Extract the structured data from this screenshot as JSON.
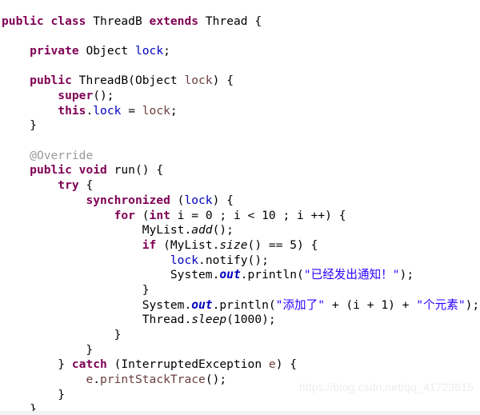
{
  "document": {
    "kind": "source-code-screenshot",
    "language": "Java",
    "class_name": "ThreadB",
    "watermark": "https://blog.csdn.net/qq_41723615"
  },
  "colors": {
    "background": "#ffffff",
    "keyword": "#7f0055",
    "field": "#0000c0",
    "string": "#2a00ff",
    "annotation": "#999999",
    "parameter": "#6a3e3e",
    "plain": "#000000",
    "watermark": "#ededed",
    "bottom_strip": "#f2f2f2"
  },
  "code": {
    "lines": [
      {
        "n": 1,
        "tokens": [
          {
            "t": "public",
            "c": "kw"
          },
          {
            "t": " ",
            "c": "pln"
          },
          {
            "t": "class",
            "c": "kw"
          },
          {
            "t": " ThreadB ",
            "c": "pln"
          },
          {
            "t": "extends",
            "c": "kw"
          },
          {
            "t": " Thread {",
            "c": "pln"
          }
        ]
      },
      {
        "n": 2,
        "tokens": []
      },
      {
        "n": 3,
        "tokens": [
          {
            "t": "    ",
            "c": "pln"
          },
          {
            "t": "private",
            "c": "kw"
          },
          {
            "t": " Object ",
            "c": "pln"
          },
          {
            "t": "lock",
            "c": "fld"
          },
          {
            "t": ";",
            "c": "pln"
          }
        ]
      },
      {
        "n": 4,
        "tokens": []
      },
      {
        "n": 5,
        "tokens": [
          {
            "t": "    ",
            "c": "pln"
          },
          {
            "t": "public",
            "c": "kw"
          },
          {
            "t": " ThreadB(Object ",
            "c": "pln"
          },
          {
            "t": "lock",
            "c": "par"
          },
          {
            "t": ") {",
            "c": "pln"
          }
        ]
      },
      {
        "n": 6,
        "tokens": [
          {
            "t": "        ",
            "c": "pln"
          },
          {
            "t": "super",
            "c": "kw"
          },
          {
            "t": "();",
            "c": "pln"
          }
        ]
      },
      {
        "n": 7,
        "tokens": [
          {
            "t": "        ",
            "c": "pln"
          },
          {
            "t": "this",
            "c": "kw"
          },
          {
            "t": ".",
            "c": "pln"
          },
          {
            "t": "lock",
            "c": "fld"
          },
          {
            "t": " = ",
            "c": "pln"
          },
          {
            "t": "lock",
            "c": "par"
          },
          {
            "t": ";",
            "c": "pln"
          }
        ]
      },
      {
        "n": 8,
        "tokens": [
          {
            "t": "    }",
            "c": "pln"
          }
        ]
      },
      {
        "n": 9,
        "tokens": []
      },
      {
        "n": 10,
        "tokens": [
          {
            "t": "    ",
            "c": "pln"
          },
          {
            "t": "@Override",
            "c": "ann"
          }
        ]
      },
      {
        "n": 11,
        "tokens": [
          {
            "t": "    ",
            "c": "pln"
          },
          {
            "t": "public",
            "c": "kw"
          },
          {
            "t": " ",
            "c": "pln"
          },
          {
            "t": "void",
            "c": "kw"
          },
          {
            "t": " run() {",
            "c": "pln"
          }
        ]
      },
      {
        "n": 12,
        "tokens": [
          {
            "t": "        ",
            "c": "pln"
          },
          {
            "t": "try",
            "c": "kw"
          },
          {
            "t": " {",
            "c": "pln"
          }
        ]
      },
      {
        "n": 13,
        "tokens": [
          {
            "t": "            ",
            "c": "pln"
          },
          {
            "t": "synchronized",
            "c": "kw"
          },
          {
            "t": " (",
            "c": "pln"
          },
          {
            "t": "lock",
            "c": "fld"
          },
          {
            "t": ") {",
            "c": "pln"
          }
        ]
      },
      {
        "n": 14,
        "tokens": [
          {
            "t": "                ",
            "c": "pln"
          },
          {
            "t": "for",
            "c": "kw"
          },
          {
            "t": " (",
            "c": "pln"
          },
          {
            "t": "int",
            "c": "kw"
          },
          {
            "t": " i = 0 ; i < 10 ; i ++) {",
            "c": "pln"
          }
        ]
      },
      {
        "n": 15,
        "tokens": [
          {
            "t": "                    MyList.",
            "c": "pln"
          },
          {
            "t": "add",
            "c": "mth"
          },
          {
            "t": "();",
            "c": "pln"
          }
        ]
      },
      {
        "n": 16,
        "tokens": [
          {
            "t": "                    ",
            "c": "pln"
          },
          {
            "t": "if",
            "c": "kw"
          },
          {
            "t": " (MyList.",
            "c": "pln"
          },
          {
            "t": "size",
            "c": "mth"
          },
          {
            "t": "() == 5) {",
            "c": "pln"
          }
        ]
      },
      {
        "n": 17,
        "tokens": [
          {
            "t": "                        ",
            "c": "pln"
          },
          {
            "t": "lock",
            "c": "fld"
          },
          {
            "t": ".notify();",
            "c": "pln"
          }
        ]
      },
      {
        "n": 18,
        "tokens": [
          {
            "t": "                        System.",
            "c": "pln"
          },
          {
            "t": "out",
            "c": "fldb"
          },
          {
            "t": ".println(",
            "c": "pln"
          },
          {
            "t": "\"已经发出通知！\"",
            "c": "str"
          },
          {
            "t": ");",
            "c": "pln"
          }
        ]
      },
      {
        "n": 19,
        "tokens": [
          {
            "t": "                    }",
            "c": "pln"
          }
        ]
      },
      {
        "n": 20,
        "tokens": [
          {
            "t": "                    System.",
            "c": "pln"
          },
          {
            "t": "out",
            "c": "fldb"
          },
          {
            "t": ".println(",
            "c": "pln"
          },
          {
            "t": "\"添加了\"",
            "c": "str"
          },
          {
            "t": " + (i + 1) + ",
            "c": "pln"
          },
          {
            "t": "\"个元素\"",
            "c": "str"
          },
          {
            "t": ");",
            "c": "pln"
          }
        ]
      },
      {
        "n": 21,
        "tokens": [
          {
            "t": "                    Thread.",
            "c": "pln"
          },
          {
            "t": "sleep",
            "c": "mth"
          },
          {
            "t": "(1000);",
            "c": "pln"
          }
        ]
      },
      {
        "n": 22,
        "tokens": [
          {
            "t": "                }",
            "c": "pln"
          }
        ]
      },
      {
        "n": 23,
        "tokens": [
          {
            "t": "            }",
            "c": "pln"
          }
        ]
      },
      {
        "n": 24,
        "tokens": [
          {
            "t": "        } ",
            "c": "pln"
          },
          {
            "t": "catch",
            "c": "kw"
          },
          {
            "t": " (InterruptedException ",
            "c": "pln"
          },
          {
            "t": "e",
            "c": "par"
          },
          {
            "t": ") {",
            "c": "pln"
          }
        ]
      },
      {
        "n": 25,
        "tokens": [
          {
            "t": "            ",
            "c": "pln"
          },
          {
            "t": "e",
            "c": "par"
          },
          {
            "t": ".",
            "c": "pln"
          },
          {
            "t": "printStackTrace",
            "c": "par"
          },
          {
            "t": "();",
            "c": "pln"
          }
        ]
      },
      {
        "n": 26,
        "tokens": [
          {
            "t": "        }",
            "c": "pln"
          }
        ]
      },
      {
        "n": 27,
        "tokens": [
          {
            "t": "    }",
            "c": "pln"
          }
        ]
      }
    ],
    "plain_text": "public class ThreadB extends Thread {\n\n    private Object lock;\n\n    public ThreadB(Object lock) {\n        super();\n        this.lock = lock;\n    }\n\n    @Override\n    public void run() {\n        try {\n            synchronized (lock) {\n                for (int i = 0 ; i < 10 ; i ++) {\n                    MyList.add();\n                    if (MyList.size() == 5) {\n                        lock.notify();\n                        System.out.println(\"已经发出通知！\");\n                    }\n                    System.out.println(\"添加了\" + (i + 1) + \"个元素\");\n                    Thread.sleep(1000);\n                }\n            }\n        } catch (InterruptedException e) {\n            e.printStackTrace();\n        }\n    }"
  }
}
